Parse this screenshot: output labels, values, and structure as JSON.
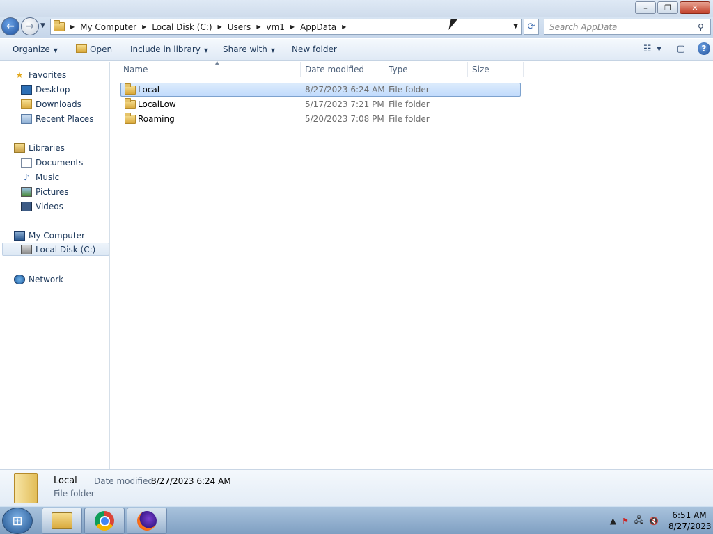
{
  "window": {
    "minimize": "–",
    "maximize": "❐",
    "close": "✕"
  },
  "address": {
    "crumbs": [
      "My Computer",
      "Local Disk (C:)",
      "Users",
      "vm1",
      "AppData"
    ]
  },
  "search": {
    "placeholder": "Search AppData"
  },
  "toolbar": {
    "organize": "Organize",
    "open": "Open",
    "include_in_library": "Include in library",
    "share_with": "Share with",
    "new_folder": "New folder"
  },
  "nav": {
    "favorites": "Favorites",
    "desktop": "Desktop",
    "downloads": "Downloads",
    "recent_places": "Recent Places",
    "libraries": "Libraries",
    "documents": "Documents",
    "music": "Music",
    "pictures": "Pictures",
    "videos": "Videos",
    "my_computer": "My Computer",
    "local_disk": "Local Disk (C:)",
    "network": "Network"
  },
  "columns": {
    "name": "Name",
    "date_modified": "Date modified",
    "type": "Type",
    "size": "Size"
  },
  "files": [
    {
      "name": "Local",
      "date": "8/27/2023 6:24 AM",
      "type": "File folder",
      "selected": true
    },
    {
      "name": "LocalLow",
      "date": "5/17/2023 7:21 PM",
      "type": "File folder",
      "selected": false
    },
    {
      "name": "Roaming",
      "date": "5/20/2023 7:08 PM",
      "type": "File folder",
      "selected": false
    }
  ],
  "details": {
    "name": "Local",
    "date_key": "Date modified:",
    "date_value": "8/27/2023 6:24 AM",
    "type": "File folder"
  },
  "taskbar": {
    "time": "6:51 AM",
    "date": "8/27/2023"
  }
}
